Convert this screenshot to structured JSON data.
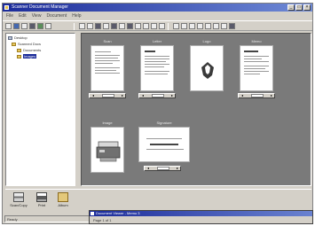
{
  "window": {
    "title": "Scanner Document Manager"
  },
  "menu": [
    "File",
    "Edit",
    "View",
    "Document",
    "Help"
  ],
  "tree": [
    {
      "label": "Desktop",
      "icon": "computer-icon"
    },
    {
      "label": "Scanned Docs",
      "icon": "folder-icon"
    },
    {
      "label": "Documents",
      "icon": "folder-icon"
    },
    {
      "label": "Images",
      "icon": "folder-icon",
      "selected": true
    }
  ],
  "thumbnails": [
    {
      "label": "Scan"
    },
    {
      "label": "Letter"
    },
    {
      "label": "Logo"
    },
    {
      "label": "Memo"
    },
    {
      "label": "Image"
    },
    {
      "label": "Signature"
    }
  ],
  "bottom_buttons": [
    {
      "label": "Scan/Copy",
      "icon": "scanner-icon"
    },
    {
      "label": "Print",
      "icon": "printer-icon"
    },
    {
      "label": "Album",
      "icon": "album-icon"
    }
  ],
  "status_text": "Ready",
  "popup": {
    "title": "Document Viewer - Memo 3",
    "body": "Page 1 of 1"
  }
}
